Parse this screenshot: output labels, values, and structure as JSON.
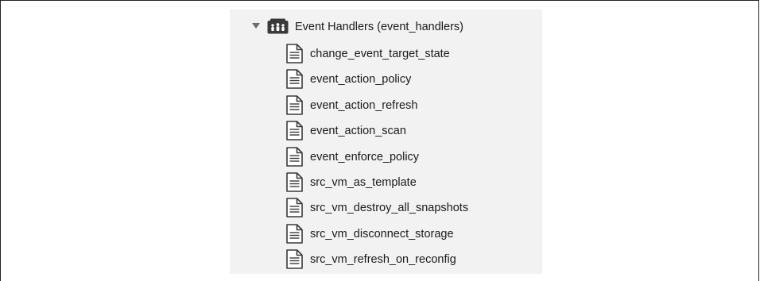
{
  "tree": {
    "root": {
      "label": "Event Handlers (event_handlers)",
      "expanded": true,
      "icon": "namespace-folder-icon"
    },
    "items": [
      {
        "label": "change_event_target_state",
        "icon": "document-icon"
      },
      {
        "label": "event_action_policy",
        "icon": "document-icon"
      },
      {
        "label": "event_action_refresh",
        "icon": "document-icon"
      },
      {
        "label": "event_action_scan",
        "icon": "document-icon"
      },
      {
        "label": "event_enforce_policy",
        "icon": "document-icon"
      },
      {
        "label": "src_vm_as_template",
        "icon": "document-icon"
      },
      {
        "label": "src_vm_destroy_all_snapshots",
        "icon": "document-icon"
      },
      {
        "label": "src_vm_disconnect_storage",
        "icon": "document-icon"
      },
      {
        "label": "src_vm_refresh_on_reconfig",
        "icon": "document-icon"
      }
    ]
  },
  "colors": {
    "panel_background": "#f2f2f2",
    "icon_dark": "#3a3a3a",
    "text": "#1a1a1a"
  }
}
